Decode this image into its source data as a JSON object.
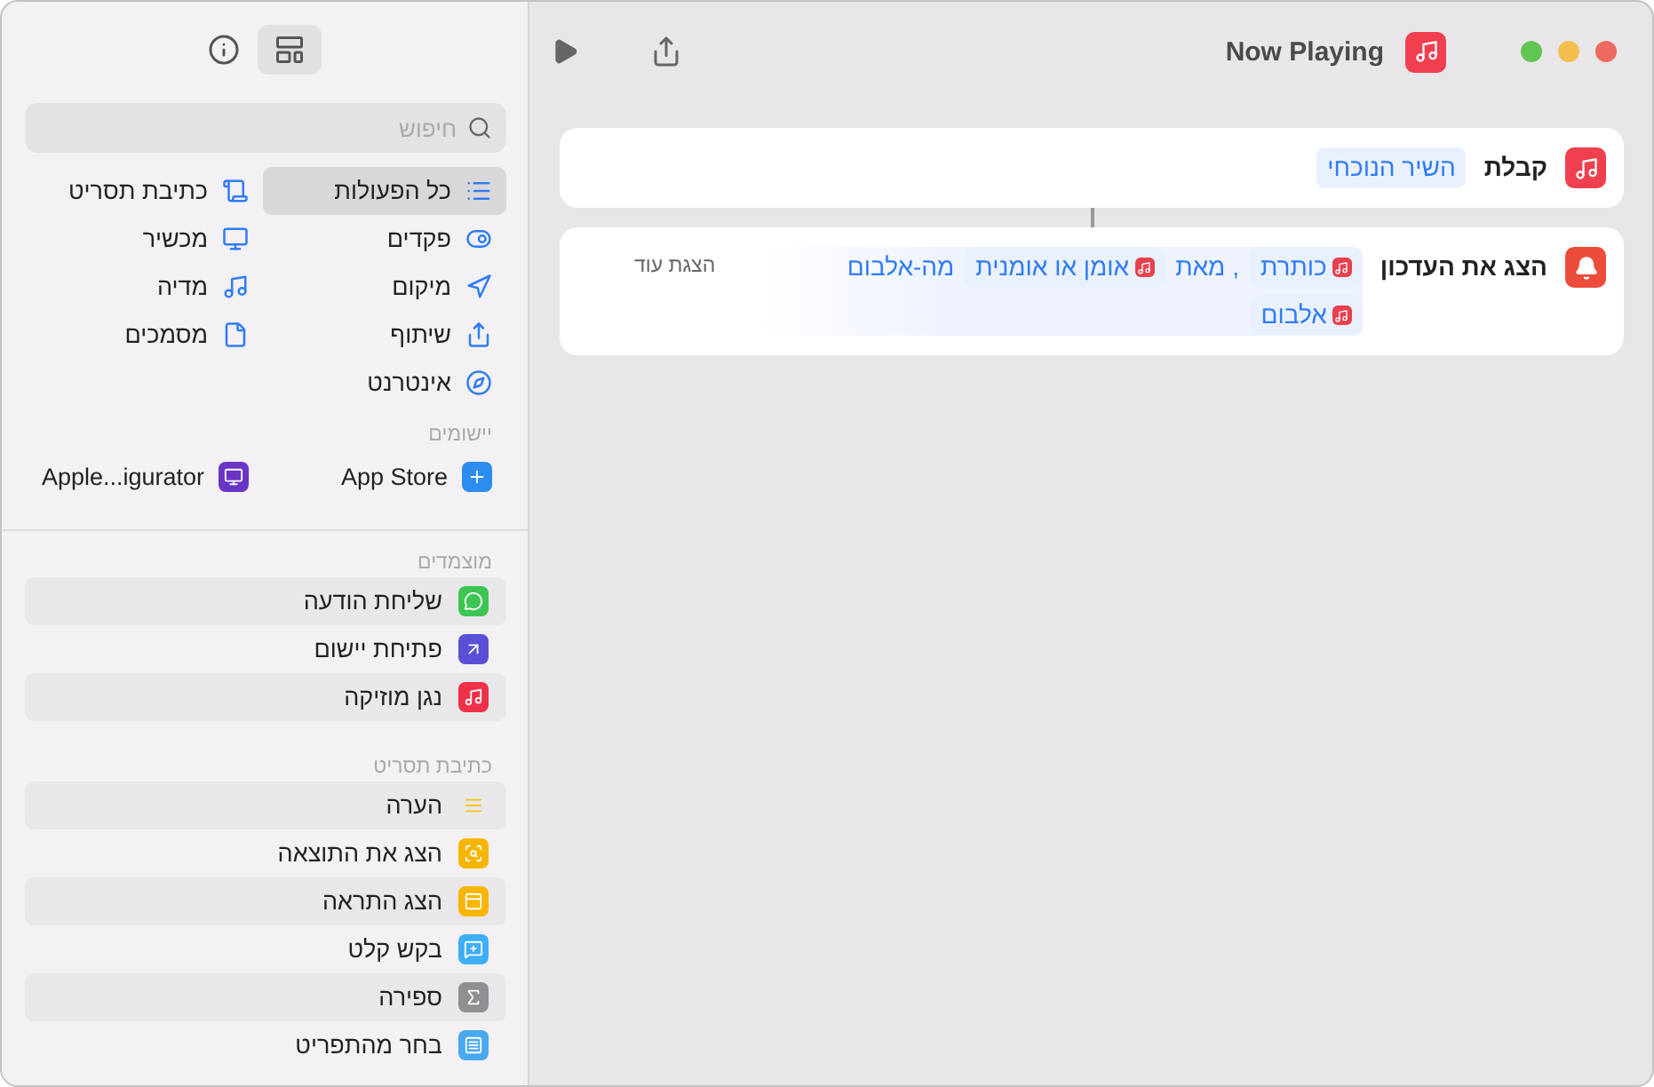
{
  "sidebar": {
    "search": {
      "placeholder": "חיפוש"
    },
    "categories": [
      {
        "label": "כל הפעולות",
        "selected": true
      },
      {
        "label": "כתיבת תסריט",
        "selected": false
      },
      {
        "label": "פקדים",
        "selected": false
      },
      {
        "label": "מכשיר",
        "selected": false
      },
      {
        "label": "מיקום",
        "selected": false
      },
      {
        "label": "מדיה",
        "selected": false
      },
      {
        "label": "שיתוף",
        "selected": false
      },
      {
        "label": "מסמכים",
        "selected": false
      },
      {
        "label": "אינטרנט",
        "selected": false
      }
    ],
    "apps_header": "יישומים",
    "apps": [
      {
        "label": "App Store"
      },
      {
        "label": "Apple...igurator"
      }
    ],
    "sections": [
      {
        "header": "מוצמדים",
        "items": [
          {
            "label": "שליחת הודעה"
          },
          {
            "label": "פתיחת יישום"
          },
          {
            "label": "נגן מוזיקה"
          }
        ]
      },
      {
        "header": "כתיבת תסריט",
        "items": [
          {
            "label": "הערה"
          },
          {
            "label": "הצג את התוצאה"
          },
          {
            "label": "הצג התראה"
          },
          {
            "label": "בקש קלט"
          },
          {
            "label": "ספירה"
          },
          {
            "label": "בחר מהתפריט"
          }
        ]
      }
    ]
  },
  "window": {
    "title": "Now Playing"
  },
  "actions": [
    {
      "title": "קבלת",
      "pieces": [
        {
          "kind": "token",
          "text": "השיר הנוכחי"
        }
      ]
    },
    {
      "title": "הצג את העדכון",
      "pieces": [
        {
          "kind": "variable",
          "text": "כותרת"
        },
        {
          "kind": "text",
          "text": ", מאת"
        },
        {
          "kind": "variable",
          "text": "אומן או אומנית"
        },
        {
          "kind": "text",
          "text": "מה-אלבום"
        },
        {
          "kind": "variable",
          "text": "אלבום"
        }
      ],
      "more": "הצגת עוד"
    }
  ]
}
